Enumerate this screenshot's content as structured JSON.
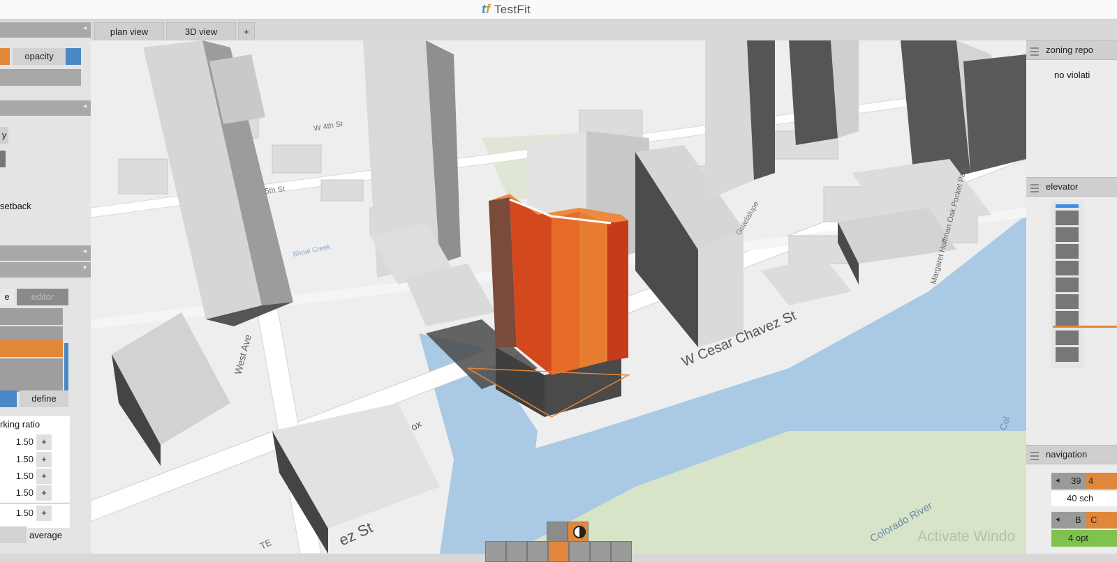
{
  "app": {
    "title": "TestFit",
    "logo": "tf"
  },
  "tabs": [
    {
      "label": "plan view"
    },
    {
      "label": "3D view"
    },
    {
      "label": "+"
    }
  ],
  "left_panel": {
    "opacity_label": "opacity",
    "y_fragment": "y",
    "setback_fragment": "setback",
    "editor_tab": "editor",
    "e_fragment": "e",
    "define_label": "define",
    "parking_label": "rking ratio",
    "ratios": [
      "1.50",
      "1.50",
      "1.50",
      "1.50",
      "1.50"
    ],
    "plus": "+",
    "average_label": "average",
    "colors": {
      "orange": "#e0873a",
      "blue": "#4a87c6",
      "header": "#a9a9a9"
    }
  },
  "right_panel": {
    "zoning_header": "zoning repo",
    "zoning_status": "no violati",
    "elevator_header": "elevator",
    "navigation_header": "navigation",
    "nav_floor": "39",
    "nav_floor_next": "4",
    "nav_schemes": "40 sch",
    "nav_b": "B",
    "nav_options": "4 opt",
    "nav_c": "C",
    "colors": {
      "blue_top": "#3d8fe0",
      "orange_line": "#e0873a",
      "green": "#7fc24d"
    }
  },
  "map_labels": {
    "street_main": "W Cesar Chavez St",
    "street_west": "West Ave",
    "street_5th": "5th St",
    "street_4th": "W 4th St",
    "street_guad": "Guadalupe",
    "creek": "Shoal Creek",
    "park": "Margaret Hoffman Oak Pocket Park",
    "river": "Colorado River",
    "street_bottom": "ez St",
    "street_lower_left": "TE",
    "nox": "ox",
    "col": "Col"
  },
  "watermark": "Activate Windo"
}
